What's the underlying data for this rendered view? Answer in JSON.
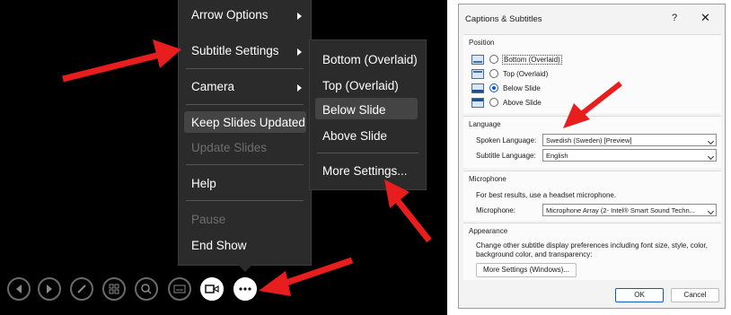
{
  "slideshow_menu": {
    "items": [
      {
        "label": "Arrow Options",
        "submenu": true,
        "enabled": true
      },
      {
        "label": "Subtitle Settings",
        "submenu": true,
        "enabled": true
      },
      {
        "label": "Camera",
        "submenu": true,
        "enabled": true
      },
      {
        "label": "Keep Slides Updated",
        "submenu": false,
        "enabled": true
      },
      {
        "label": "Update Slides",
        "submenu": false,
        "enabled": false
      },
      {
        "label": "Help",
        "submenu": false,
        "enabled": true
      },
      {
        "label": "Pause",
        "submenu": false,
        "enabled": false
      },
      {
        "label": "End Show",
        "submenu": false,
        "enabled": true
      }
    ]
  },
  "subtitle_submenu": {
    "items": [
      {
        "label": "Bottom (Overlaid)"
      },
      {
        "label": "Top (Overlaid)"
      },
      {
        "label": "Below Slide"
      },
      {
        "label": "Above Slide"
      },
      {
        "label": "More Settings..."
      }
    ],
    "highlighted": "Below Slide"
  },
  "toolbar": {
    "buttons": [
      "previous-slide",
      "next-slide",
      "pen",
      "see-all-slides",
      "zoom",
      "subtitles",
      "camera",
      "more-options"
    ]
  },
  "colors": {
    "annotation_arrow": "#e81e1e",
    "accent": "#0a5bc4"
  },
  "dialog": {
    "title": "Captions & Subtitles",
    "help": "?",
    "close": "✕",
    "position": {
      "heading": "Position",
      "options": [
        "Bottom (Overlaid)",
        "Top (Overlaid)",
        "Below Slide",
        "Above Slide"
      ],
      "selected": "Below Slide"
    },
    "language": {
      "heading": "Language",
      "spoken_label": "Spoken Language:",
      "spoken_value": "Swedish (Sweden) [Preview]",
      "subtitle_label": "Subtitle Language:",
      "subtitle_value": "English"
    },
    "microphone": {
      "heading": "Microphone",
      "hint": "For best results, use a headset microphone.",
      "label": "Microphone:",
      "value": "Microphone Array (2- Intel® Smart Sound Techn..."
    },
    "appearance": {
      "heading": "Appearance",
      "text": "Change other subtitle display preferences including font size, style, color, background color, and transparency:",
      "button": "More Settings (Windows)..."
    },
    "ok": "OK",
    "cancel": "Cancel"
  }
}
